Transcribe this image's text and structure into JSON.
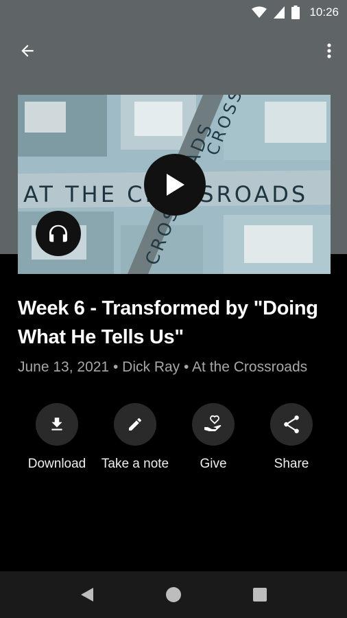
{
  "status_bar": {
    "time": "10:26"
  },
  "app_bar": {
    "back_icon": "arrow-left-icon",
    "more_icon": "more-vert-icon"
  },
  "media": {
    "artwork_title": "AT THE CROSSROADS",
    "artwork_vertical_text": "CROSSROADS",
    "play_icon": "play-icon",
    "audio_icon": "headphones-icon"
  },
  "sermon": {
    "title": "Week 6 - Transformed by \"Doing What He Tells Us\"",
    "date": "June 13, 2021",
    "speaker": "Dick Ray",
    "series": "At the Crossroads",
    "separator": " • "
  },
  "actions": [
    {
      "label": "Download",
      "icon": "download-icon"
    },
    {
      "label": "Take a note",
      "icon": "pencil-icon"
    },
    {
      "label": "Give",
      "icon": "give-heart-hand-icon"
    },
    {
      "label": "Share",
      "icon": "share-icon"
    }
  ],
  "colors": {
    "header_bg": "#5f6566",
    "page_bg": "#000000",
    "meta_text": "#a7a7a7",
    "action_circle": "#2a2a2a"
  }
}
